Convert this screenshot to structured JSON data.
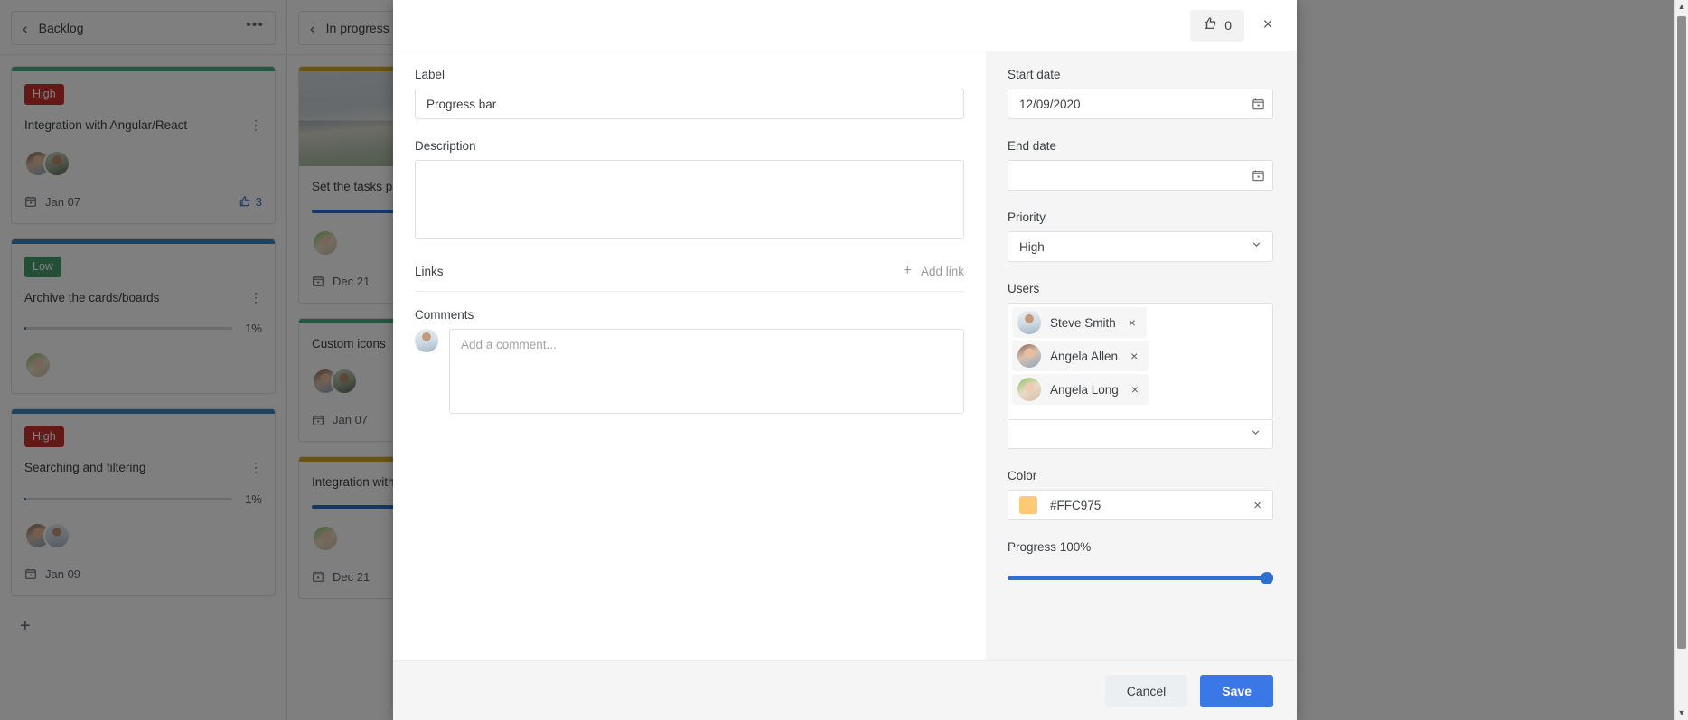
{
  "board": {
    "columns": [
      {
        "title": "Backlog",
        "menu_icon": "•••",
        "back_icon": "‹",
        "add_icon": "+",
        "cards": [
          {
            "topbar_color": "#4caf84",
            "badge": "High",
            "badge_color": "#c9322f",
            "title": "Integration with Angular/React",
            "kebab": "⋮",
            "has_progress": false,
            "avatars": [
              "allen",
              "dark"
            ],
            "date": "Jan 07",
            "likes": "3"
          },
          {
            "topbar_color": "#3f87bd",
            "badge": "Low",
            "badge_color": "#4a9d6e",
            "title": "Archive the cards/boards",
            "kebab": "⋮",
            "has_progress": true,
            "progress_pct": "1%",
            "progress_value": 1,
            "avatars": [
              "long"
            ],
            "date": "",
            "likes": ""
          },
          {
            "topbar_color": "#3f87bd",
            "badge": "High",
            "badge_color": "#c9322f",
            "title": "Searching and filtering",
            "kebab": "⋮",
            "has_progress": true,
            "progress_pct": "1%",
            "progress_value": 1,
            "avatars": [
              "allen",
              "steve"
            ],
            "date": "Jan 09",
            "likes": ""
          }
        ]
      },
      {
        "title": "In progress",
        "menu_icon": "•••",
        "back_icon": "‹",
        "add_icon": "+",
        "cards": [
          {
            "topbar_color": "#d7a535",
            "image": "mountain-landscape",
            "title": "Set the tasks p",
            "has_thick_progress": true,
            "avatars": [
              "long"
            ],
            "date": "Dec 21"
          },
          {
            "topbar_color": "#4caf84",
            "title": "Custom icons",
            "avatars": [
              "allen",
              "dark"
            ],
            "date": "Jan 07"
          },
          {
            "topbar_color": "#d7a535",
            "title": "Integration with",
            "has_thick_progress": true,
            "avatars": [
              "long"
            ],
            "date": "Dec 21"
          }
        ]
      }
    ]
  },
  "modal": {
    "header": {
      "like_icon": "thumbs-up-icon",
      "like_count": "0",
      "close_icon": "×"
    },
    "left": {
      "label_label": "Label",
      "label_value": "Progress bar",
      "description_label": "Description",
      "description_value": "",
      "links_label": "Links",
      "add_link_label": "Add link",
      "add_link_plus": "+",
      "comments_label": "Comments",
      "comment_placeholder": "Add a comment..."
    },
    "right": {
      "start_date_label": "Start date",
      "start_date_value": "12/09/2020",
      "end_date_label": "End date",
      "end_date_value": "",
      "priority_label": "Priority",
      "priority_value": "High",
      "users_label": "Users",
      "users": [
        {
          "name": "Steve Smith",
          "remove_icon": "×",
          "avatar": "steve"
        },
        {
          "name": "Angela Allen",
          "remove_icon": "×",
          "avatar": "allen"
        },
        {
          "name": "Angela Long",
          "remove_icon": "×",
          "avatar": "long"
        }
      ],
      "color_label": "Color",
      "color_value": "#FFC975",
      "color_swatch": "#FFC975",
      "color_clear_icon": "×",
      "progress_label": "Progress 100%",
      "progress_value": 100
    },
    "footer": {
      "cancel_label": "Cancel",
      "save_label": "Save"
    }
  }
}
